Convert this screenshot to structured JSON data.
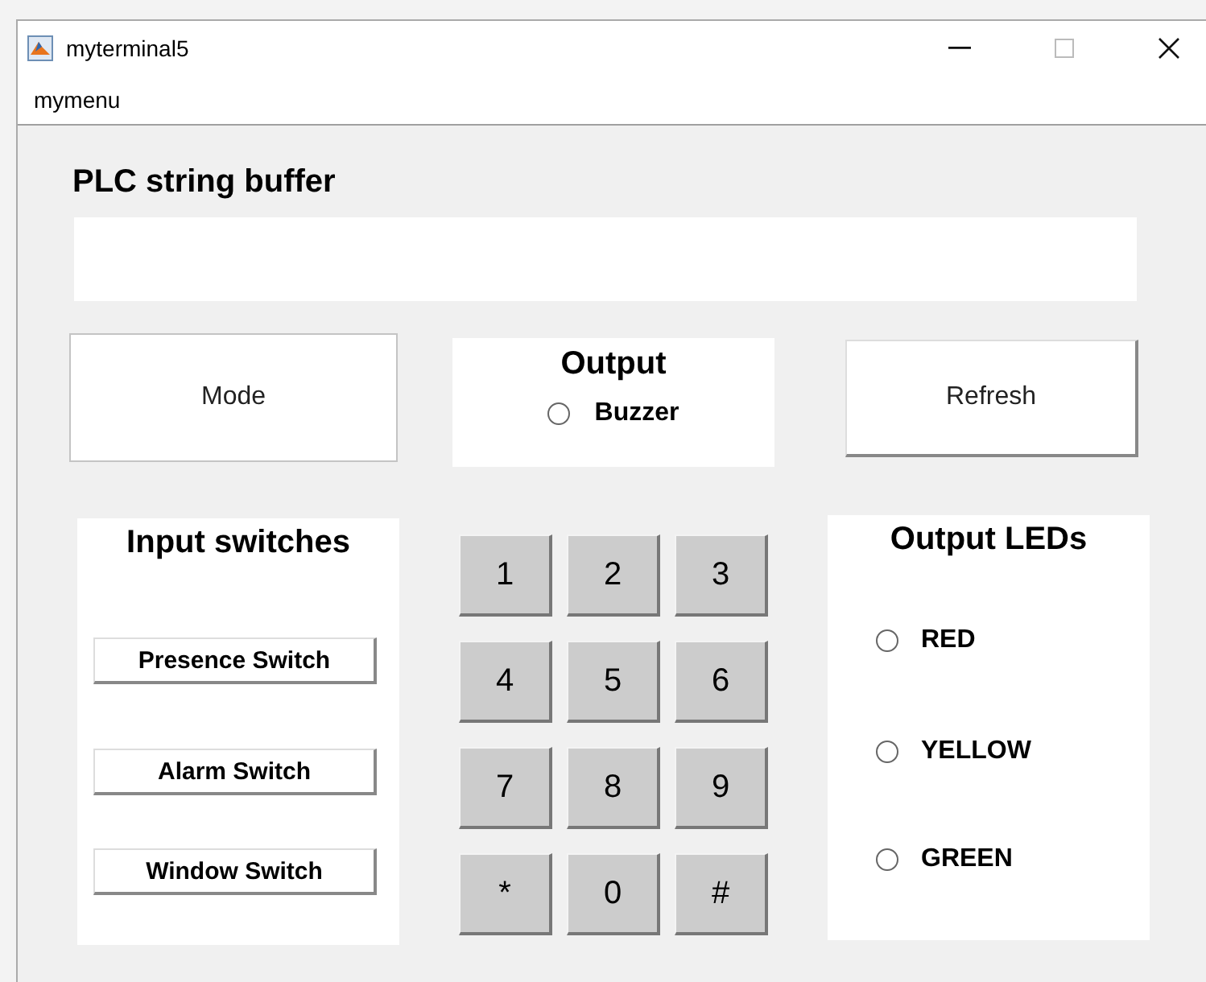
{
  "window": {
    "title": "myterminal5"
  },
  "menu": [
    "mymenu"
  ],
  "buffer": {
    "label": "PLC string buffer"
  },
  "mode_button": "Mode",
  "output": {
    "title": "Output",
    "radios": [
      {
        "label": "Buzzer",
        "selected": false
      }
    ]
  },
  "refresh_button": "Refresh",
  "input_switches": {
    "title": "Input switches",
    "buttons": [
      "Presence Switch",
      "Alarm Switch",
      "Window Switch"
    ]
  },
  "keypad": [
    "1",
    "2",
    "3",
    "4",
    "5",
    "6",
    "7",
    "8",
    "9",
    "*",
    "0",
    "#"
  ],
  "output_leds": {
    "title": "Output LEDs",
    "radios": [
      {
        "label": "RED",
        "selected": false
      },
      {
        "label": "YELLOW",
        "selected": false
      },
      {
        "label": "GREEN",
        "selected": false
      }
    ]
  }
}
